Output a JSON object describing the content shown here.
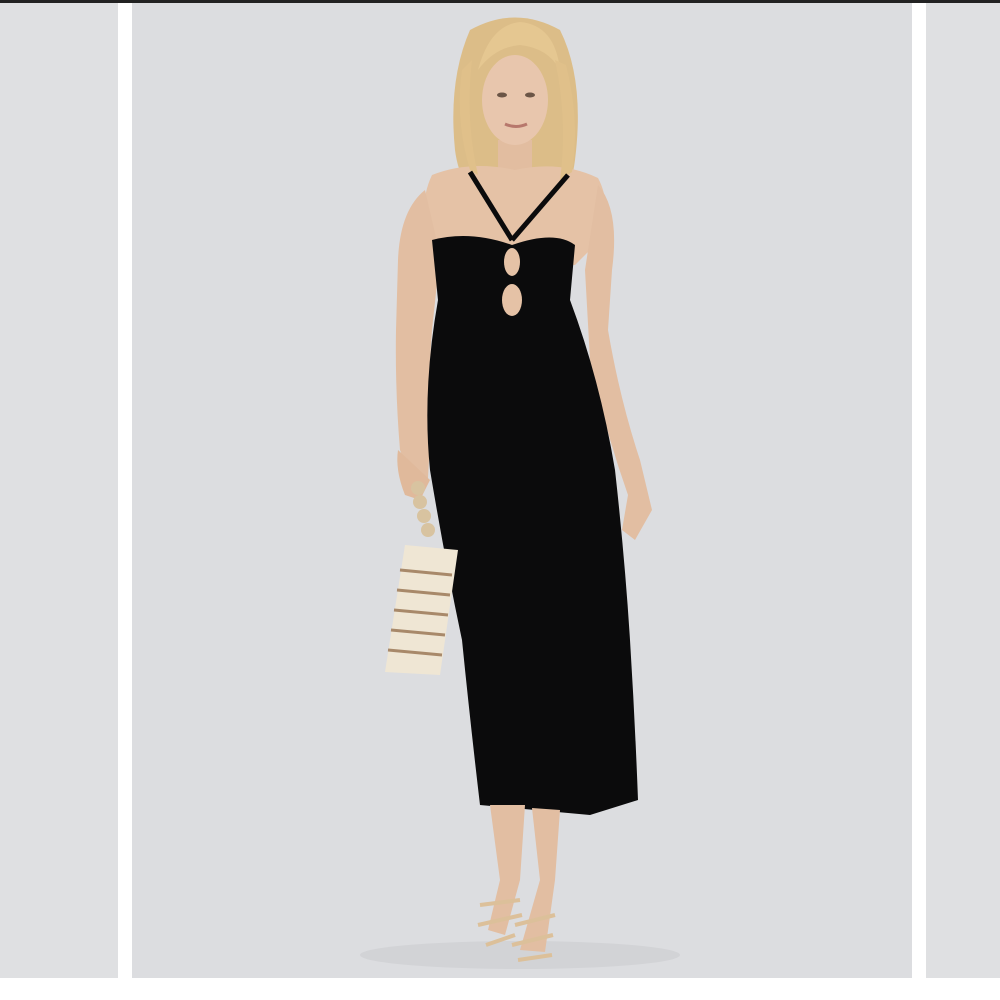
{
  "gallery": {
    "background_color": "#dcdde0",
    "main_image": {
      "subject": "model-photo"
    },
    "zoom_button": {
      "icon": "magnifier-icon"
    }
  },
  "colors": {
    "dress": "#0b0b0c",
    "skin": "#e5c2a6",
    "hair": "#e2c48c",
    "bag": "#efe6d4",
    "sandal": "#dcc09a"
  }
}
